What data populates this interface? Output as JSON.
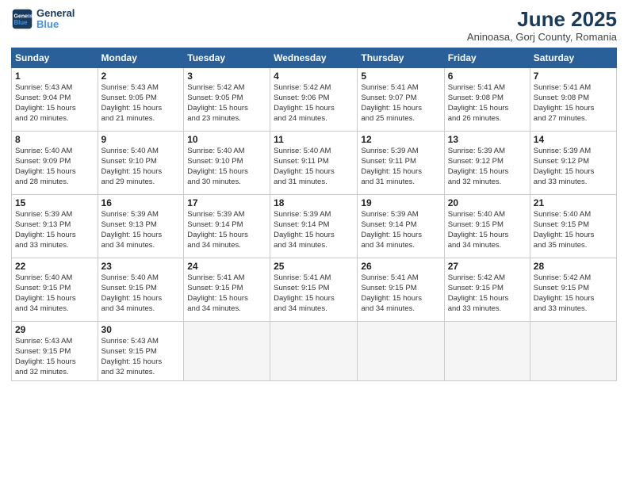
{
  "header": {
    "logo_line1": "General",
    "logo_line2": "Blue",
    "month": "June 2025",
    "location": "Aninoasa, Gorj County, Romania"
  },
  "weekdays": [
    "Sunday",
    "Monday",
    "Tuesday",
    "Wednesday",
    "Thursday",
    "Friday",
    "Saturday"
  ],
  "weeks": [
    [
      {
        "day": "1",
        "info": "Sunrise: 5:43 AM\nSunset: 9:04 PM\nDaylight: 15 hours\nand 20 minutes."
      },
      {
        "day": "2",
        "info": "Sunrise: 5:43 AM\nSunset: 9:05 PM\nDaylight: 15 hours\nand 21 minutes."
      },
      {
        "day": "3",
        "info": "Sunrise: 5:42 AM\nSunset: 9:05 PM\nDaylight: 15 hours\nand 23 minutes."
      },
      {
        "day": "4",
        "info": "Sunrise: 5:42 AM\nSunset: 9:06 PM\nDaylight: 15 hours\nand 24 minutes."
      },
      {
        "day": "5",
        "info": "Sunrise: 5:41 AM\nSunset: 9:07 PM\nDaylight: 15 hours\nand 25 minutes."
      },
      {
        "day": "6",
        "info": "Sunrise: 5:41 AM\nSunset: 9:08 PM\nDaylight: 15 hours\nand 26 minutes."
      },
      {
        "day": "7",
        "info": "Sunrise: 5:41 AM\nSunset: 9:08 PM\nDaylight: 15 hours\nand 27 minutes."
      }
    ],
    [
      {
        "day": "8",
        "info": "Sunrise: 5:40 AM\nSunset: 9:09 PM\nDaylight: 15 hours\nand 28 minutes."
      },
      {
        "day": "9",
        "info": "Sunrise: 5:40 AM\nSunset: 9:10 PM\nDaylight: 15 hours\nand 29 minutes."
      },
      {
        "day": "10",
        "info": "Sunrise: 5:40 AM\nSunset: 9:10 PM\nDaylight: 15 hours\nand 30 minutes."
      },
      {
        "day": "11",
        "info": "Sunrise: 5:40 AM\nSunset: 9:11 PM\nDaylight: 15 hours\nand 31 minutes."
      },
      {
        "day": "12",
        "info": "Sunrise: 5:39 AM\nSunset: 9:11 PM\nDaylight: 15 hours\nand 31 minutes."
      },
      {
        "day": "13",
        "info": "Sunrise: 5:39 AM\nSunset: 9:12 PM\nDaylight: 15 hours\nand 32 minutes."
      },
      {
        "day": "14",
        "info": "Sunrise: 5:39 AM\nSunset: 9:12 PM\nDaylight: 15 hours\nand 33 minutes."
      }
    ],
    [
      {
        "day": "15",
        "info": "Sunrise: 5:39 AM\nSunset: 9:13 PM\nDaylight: 15 hours\nand 33 minutes."
      },
      {
        "day": "16",
        "info": "Sunrise: 5:39 AM\nSunset: 9:13 PM\nDaylight: 15 hours\nand 34 minutes."
      },
      {
        "day": "17",
        "info": "Sunrise: 5:39 AM\nSunset: 9:14 PM\nDaylight: 15 hours\nand 34 minutes."
      },
      {
        "day": "18",
        "info": "Sunrise: 5:39 AM\nSunset: 9:14 PM\nDaylight: 15 hours\nand 34 minutes."
      },
      {
        "day": "19",
        "info": "Sunrise: 5:39 AM\nSunset: 9:14 PM\nDaylight: 15 hours\nand 34 minutes."
      },
      {
        "day": "20",
        "info": "Sunrise: 5:40 AM\nSunset: 9:15 PM\nDaylight: 15 hours\nand 34 minutes."
      },
      {
        "day": "21",
        "info": "Sunrise: 5:40 AM\nSunset: 9:15 PM\nDaylight: 15 hours\nand 35 minutes."
      }
    ],
    [
      {
        "day": "22",
        "info": "Sunrise: 5:40 AM\nSunset: 9:15 PM\nDaylight: 15 hours\nand 34 minutes."
      },
      {
        "day": "23",
        "info": "Sunrise: 5:40 AM\nSunset: 9:15 PM\nDaylight: 15 hours\nand 34 minutes."
      },
      {
        "day": "24",
        "info": "Sunrise: 5:41 AM\nSunset: 9:15 PM\nDaylight: 15 hours\nand 34 minutes."
      },
      {
        "day": "25",
        "info": "Sunrise: 5:41 AM\nSunset: 9:15 PM\nDaylight: 15 hours\nand 34 minutes."
      },
      {
        "day": "26",
        "info": "Sunrise: 5:41 AM\nSunset: 9:15 PM\nDaylight: 15 hours\nand 34 minutes."
      },
      {
        "day": "27",
        "info": "Sunrise: 5:42 AM\nSunset: 9:15 PM\nDaylight: 15 hours\nand 33 minutes."
      },
      {
        "day": "28",
        "info": "Sunrise: 5:42 AM\nSunset: 9:15 PM\nDaylight: 15 hours\nand 33 minutes."
      }
    ],
    [
      {
        "day": "29",
        "info": "Sunrise: 5:43 AM\nSunset: 9:15 PM\nDaylight: 15 hours\nand 32 minutes."
      },
      {
        "day": "30",
        "info": "Sunrise: 5:43 AM\nSunset: 9:15 PM\nDaylight: 15 hours\nand 32 minutes."
      },
      {
        "day": "",
        "info": ""
      },
      {
        "day": "",
        "info": ""
      },
      {
        "day": "",
        "info": ""
      },
      {
        "day": "",
        "info": ""
      },
      {
        "day": "",
        "info": ""
      }
    ]
  ]
}
